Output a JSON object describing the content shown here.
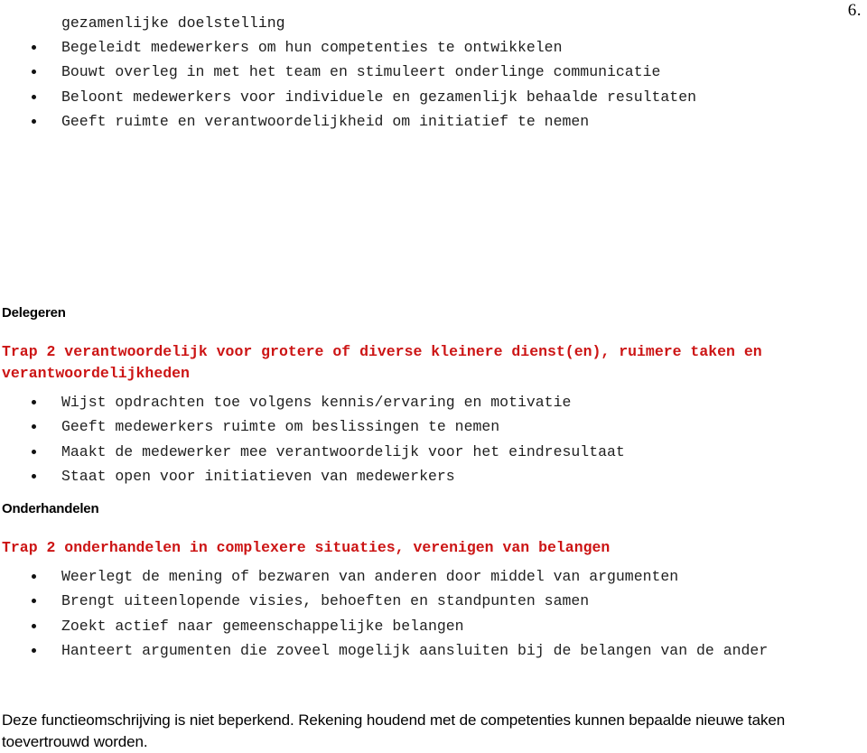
{
  "document": {
    "page_number": "6.",
    "top_continuation_line": "gezamenlijke doelstelling",
    "top_bullets": [
      "Begeleidt medewerkers om hun competenties te ontwikkelen",
      "Bouwt overleg in met het team en stimuleert onderlinge communicatie",
      "Beloont medewerkers voor individuele en gezamenlijk behaalde resultaten",
      "Geeft ruimte en verantwoordelijkheid om initiatief te nemen"
    ],
    "sections": [
      {
        "heading": "Delegeren",
        "trap_heading": "Trap 2 verantwoordelijk voor grotere of diverse kleinere dienst(en), ruimere taken en verantwoordelijkheden",
        "bullets": [
          "Wijst opdrachten toe volgens kennis/ervaring en motivatie",
          "Geeft medewerkers ruimte om beslissingen te nemen",
          "Maakt de medewerker mee verantwoordelijk voor het eindresultaat",
          "Staat open voor initiatieven van medewerkers"
        ]
      },
      {
        "heading": "Onderhandelen",
        "trap_heading": "Trap 2 onderhandelen in complexere situaties, verenigen van belangen",
        "bullets": [
          "Weerlegt de mening of bezwaren van anderen door middel van argumenten",
          "Brengt uiteenlopende visies, behoeften en standpunten samen",
          "Zoekt actief naar gemeenschappelijke belangen",
          "Hanteert argumenten die zoveel mogelijk aansluiten bij de belangen van de ander"
        ]
      }
    ],
    "footer_note": "Deze functieomschrijving is niet beperkend. Rekening houdend met de competenties kunnen bepaalde nieuwe taken toevertrouwd worden.",
    "colors": {
      "accent_red": "#cc1414",
      "body_text": "#1f1f1f",
      "background": "#ffffff"
    }
  }
}
